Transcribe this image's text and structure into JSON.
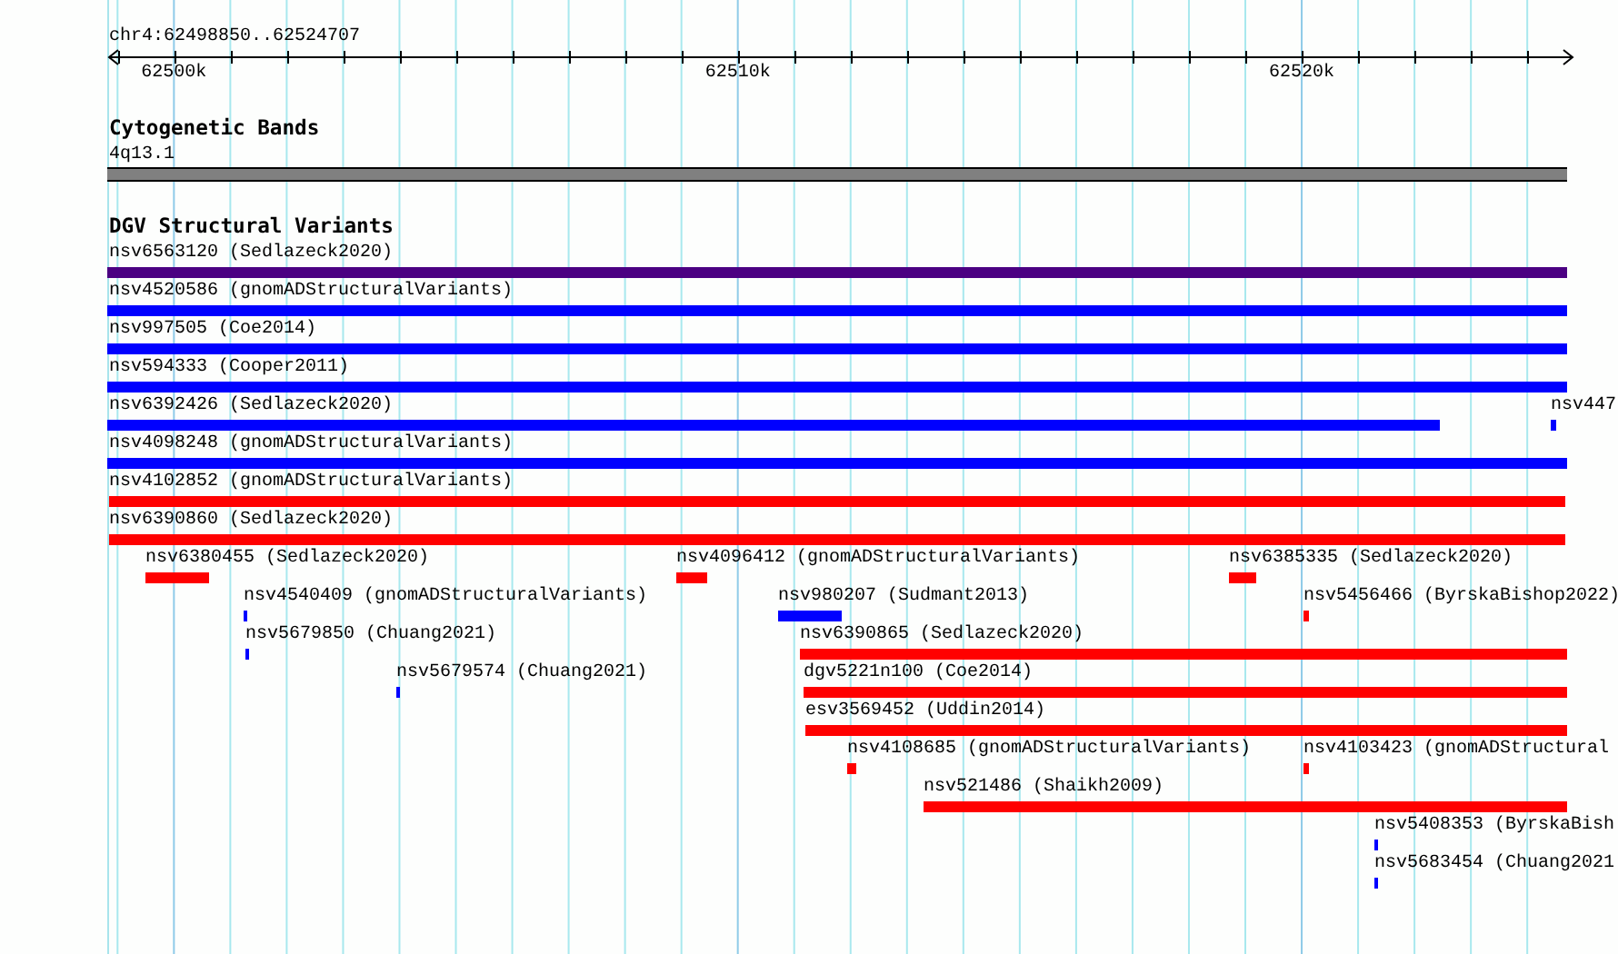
{
  "ruler": {
    "location": "chr4:62498850..62524707",
    "ticks": [
      "62500k",
      "62510k",
      "62520k"
    ]
  },
  "tracks": [
    {
      "kind": "bands",
      "title": "Cytogenetic Bands",
      "features": [
        {
          "label": "4q13.1"
        }
      ]
    },
    {
      "kind": "variants",
      "title": "DGV Structural Variants",
      "features": [
        {
          "label": "nsv6563120 (Sedlazeck2020)",
          "color": "#4b0082"
        },
        {
          "label": "nsv4520586 (gnomADStructuralVariants)",
          "color": "#0000ff"
        },
        {
          "label": "nsv997505 (Coe2014)",
          "color": "#0000ff"
        },
        {
          "label": "nsv594333 (Cooper2011)",
          "color": "#0000ff"
        },
        {
          "label": "nsv6392426 (Sedlazeck2020)",
          "color": "#0000ff"
        },
        {
          "label": "nsv447",
          "color": "#0000ff"
        },
        {
          "label": "nsv4098248 (gnomADStructuralVariants)",
          "color": "#0000ff"
        },
        {
          "label": "nsv4102852 (gnomADStructuralVariants)",
          "color": "#ff0000"
        },
        {
          "label": "nsv6390860 (Sedlazeck2020)",
          "color": "#ff0000"
        },
        {
          "label": "nsv6380455 (Sedlazeck2020)",
          "color": "#ff0000"
        },
        {
          "label": "nsv4096412 (gnomADStructuralVariants)",
          "color": "#ff0000"
        },
        {
          "label": "nsv6385335 (Sedlazeck2020)",
          "color": "#ff0000"
        },
        {
          "label": "nsv4540409 (gnomADStructuralVariants)",
          "color": "#0000ff"
        },
        {
          "label": "nsv980207 (Sudmant2013)",
          "color": "#0000ff"
        },
        {
          "label": "nsv5456466 (ByrskaBishop2022)",
          "color": "#ff0000"
        },
        {
          "label": "nsv5679850 (Chuang2021)",
          "color": "#0000ff"
        },
        {
          "label": "nsv6390865 (Sedlazeck2020)",
          "color": "#ff0000"
        },
        {
          "label": "nsv5679574 (Chuang2021)",
          "color": "#0000ff"
        },
        {
          "label": "dgv5221n100 (Coe2014)",
          "color": "#ff0000"
        },
        {
          "label": "esv3569452 (Uddin2014)",
          "color": "#ff0000"
        },
        {
          "label": "nsv4108685 (gnomADStructuralVariants)",
          "color": "#ff0000"
        },
        {
          "label": "nsv4103423 (gnomADStructural",
          "color": "#ff0000"
        },
        {
          "label": "nsv521486 (Shaikh2009)",
          "color": "#ff0000"
        },
        {
          "label": "nsv5408353 (ByrskaBish",
          "color": "#0000ff"
        },
        {
          "label": "nsv5683454 (Chuang2021",
          "color": "#0000ff"
        }
      ]
    }
  ]
}
